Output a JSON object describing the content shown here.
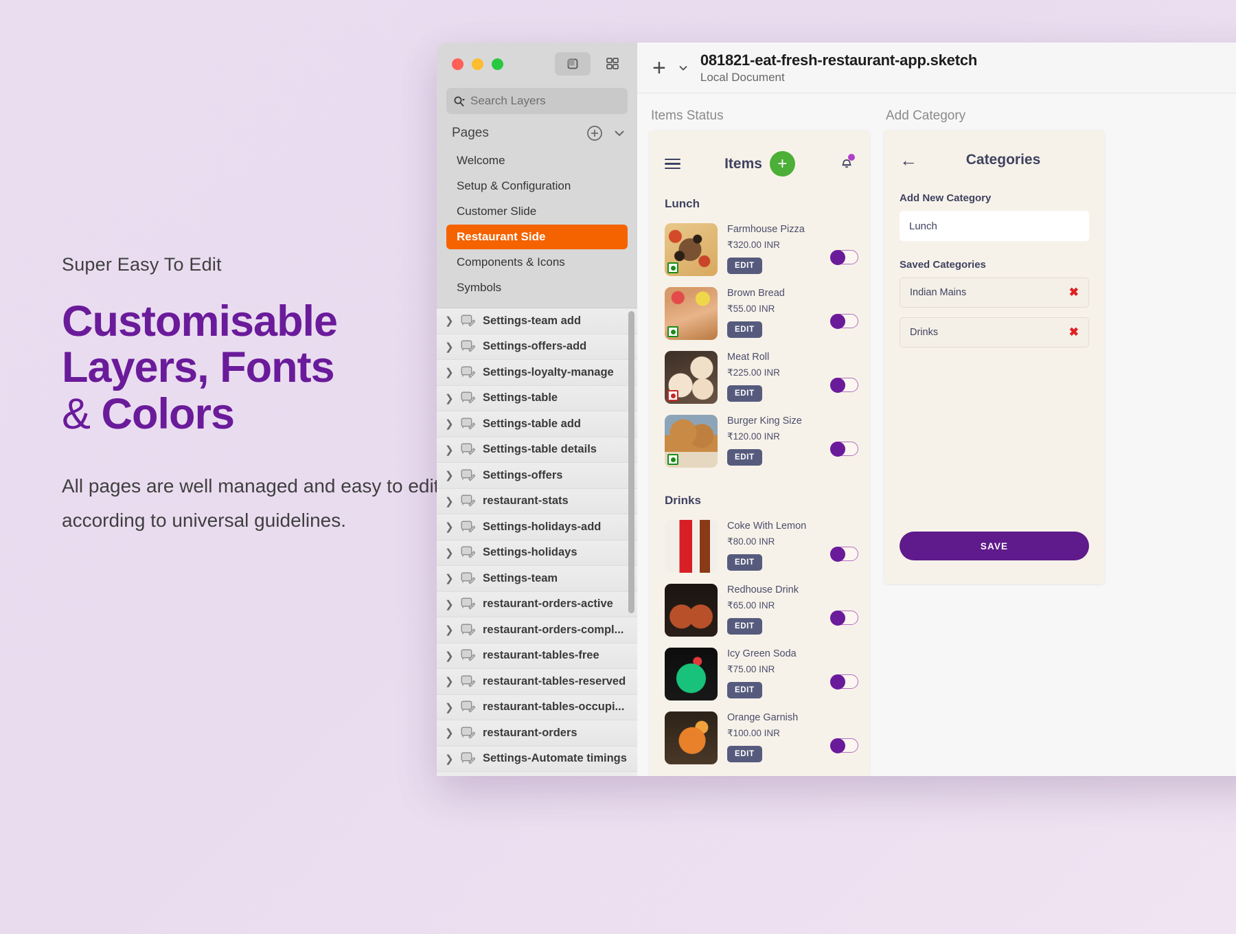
{
  "promo": {
    "eyebrow": "Super Easy To Edit",
    "title_line1": "Customisable",
    "title_line2": "Layers, Fonts",
    "title_amp": "&",
    "title_line3": "Colors",
    "body": "All pages are well managed and easy to edit according to universal guidelines.",
    "accent_color": "#6a1b9a"
  },
  "window": {
    "search": {
      "placeholder": "Search Layers"
    },
    "pages": {
      "label": "Pages",
      "items": [
        {
          "label": "Welcome",
          "selected": false
        },
        {
          "label": "Setup & Configuration",
          "selected": false
        },
        {
          "label": "Customer Slide",
          "selected": false
        },
        {
          "label": "Restaurant Side",
          "selected": true
        },
        {
          "label": "Components & Icons",
          "selected": false
        },
        {
          "label": "Symbols",
          "selected": false
        }
      ],
      "selected_color": "#f56300"
    },
    "layers": [
      "Settings-team add",
      "Settings-offers-add",
      "Settings-loyalty-manage",
      "Settings-table",
      "Settings-table add",
      "Settings-table details",
      "Settings-offers",
      "restaurant-stats",
      "Settings-holidays-add",
      "Settings-holidays",
      "Settings-team",
      "restaurant-orders-active",
      "restaurant-orders-compl...",
      "restaurant-tables-free",
      "restaurant-tables-reserved",
      "restaurant-tables-occupi...",
      "restaurant-orders",
      "Settings-Automate timings"
    ],
    "document": {
      "title": "081821-eat-fresh-restaurant-app.sketch",
      "subtitle": "Local Document"
    }
  },
  "boards": [
    {
      "label": "Items Status"
    },
    {
      "label": "Add Category"
    }
  ],
  "items_screen": {
    "title": "Items",
    "add_label": "+",
    "sections": [
      {
        "name": "Lunch",
        "items": [
          {
            "name": "Farmhouse Pizza",
            "price": "₹320.00 INR",
            "edit": "EDIT",
            "diet": "veg",
            "img": "img-pizza"
          },
          {
            "name": "Brown Bread",
            "price": "₹55.00 INR",
            "edit": "EDIT",
            "diet": "veg",
            "img": "img-bread"
          },
          {
            "name": "Meat Roll",
            "price": "₹225.00 INR",
            "edit": "EDIT",
            "diet": "nonveg",
            "img": "img-roll"
          },
          {
            "name": "Burger King Size",
            "price": "₹120.00 INR",
            "edit": "EDIT",
            "diet": "veg",
            "img": "img-burger"
          }
        ]
      },
      {
        "name": "Drinks",
        "items": [
          {
            "name": "Coke With Lemon",
            "price": "₹80.00 INR",
            "edit": "EDIT",
            "diet": "none",
            "img": "img-coke"
          },
          {
            "name": "Redhouse Drink",
            "price": "₹65.00 INR",
            "edit": "EDIT",
            "diet": "none",
            "img": "img-redhouse"
          },
          {
            "name": "Icy Green Soda",
            "price": "₹75.00 INR",
            "edit": "EDIT",
            "diet": "none",
            "img": "img-soda"
          },
          {
            "name": "Orange Garnish",
            "price": "₹100.00 INR",
            "edit": "EDIT",
            "diet": "none",
            "img": "img-orange"
          }
        ]
      }
    ]
  },
  "category_screen": {
    "title": "Categories",
    "add_new_label": "Add New Category",
    "new_category_value": "Lunch",
    "saved_label": "Saved Categories",
    "saved": [
      "Indian Mains",
      "Drinks"
    ],
    "remove_glyph": "✖",
    "save_label": "SAVE",
    "save_color": "#5f1a8b"
  }
}
